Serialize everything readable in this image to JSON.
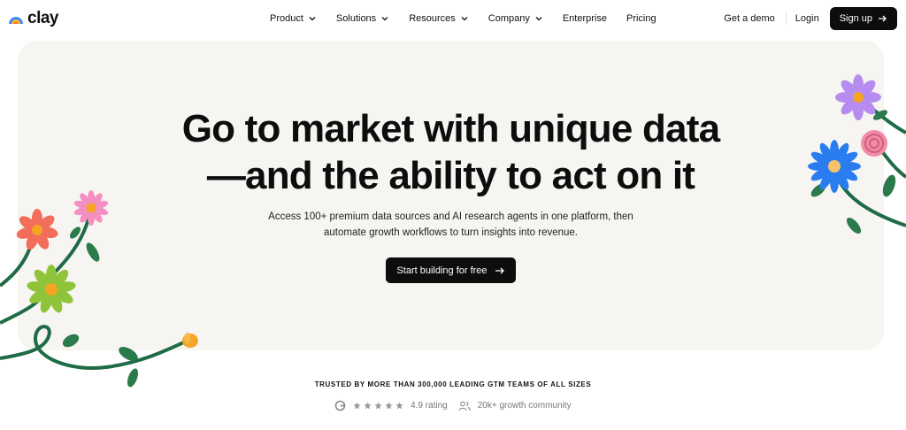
{
  "nav": {
    "logo_text": "clay",
    "items": [
      {
        "label": "Product",
        "has_dropdown": true
      },
      {
        "label": "Solutions",
        "has_dropdown": true
      },
      {
        "label": "Resources",
        "has_dropdown": true
      },
      {
        "label": "Company",
        "has_dropdown": true
      },
      {
        "label": "Enterprise",
        "has_dropdown": false
      },
      {
        "label": "Pricing",
        "has_dropdown": false
      }
    ],
    "demo_label": "Get a demo",
    "login_label": "Login",
    "signup_label": "Sign up"
  },
  "hero": {
    "headline_line1": "Go to market with unique data",
    "headline_line2": "—and the ability to act on it",
    "sub_line1": "Access 100+ premium data sources and AI research agents in one platform, then",
    "sub_line2": "automate growth workflows to turn insights into revenue.",
    "cta_label": "Start building for free"
  },
  "trust": {
    "text": "TRUSTED BY MORE THAN 300,000 LEADING GTM TEAMS OF ALL SIZES",
    "rating_label": "4.9 rating",
    "stars": 5,
    "community_label": "20k+ growth community"
  },
  "colors": {
    "brand_black": "#0d0d0d",
    "hero_bg": "#f7f5f2",
    "stem_green": "#1f6b45"
  },
  "icons": [
    "clay-logo-icon",
    "chevron-down-icon",
    "arrow-right-icon",
    "g2-icon",
    "star-icon",
    "users-icon"
  ]
}
